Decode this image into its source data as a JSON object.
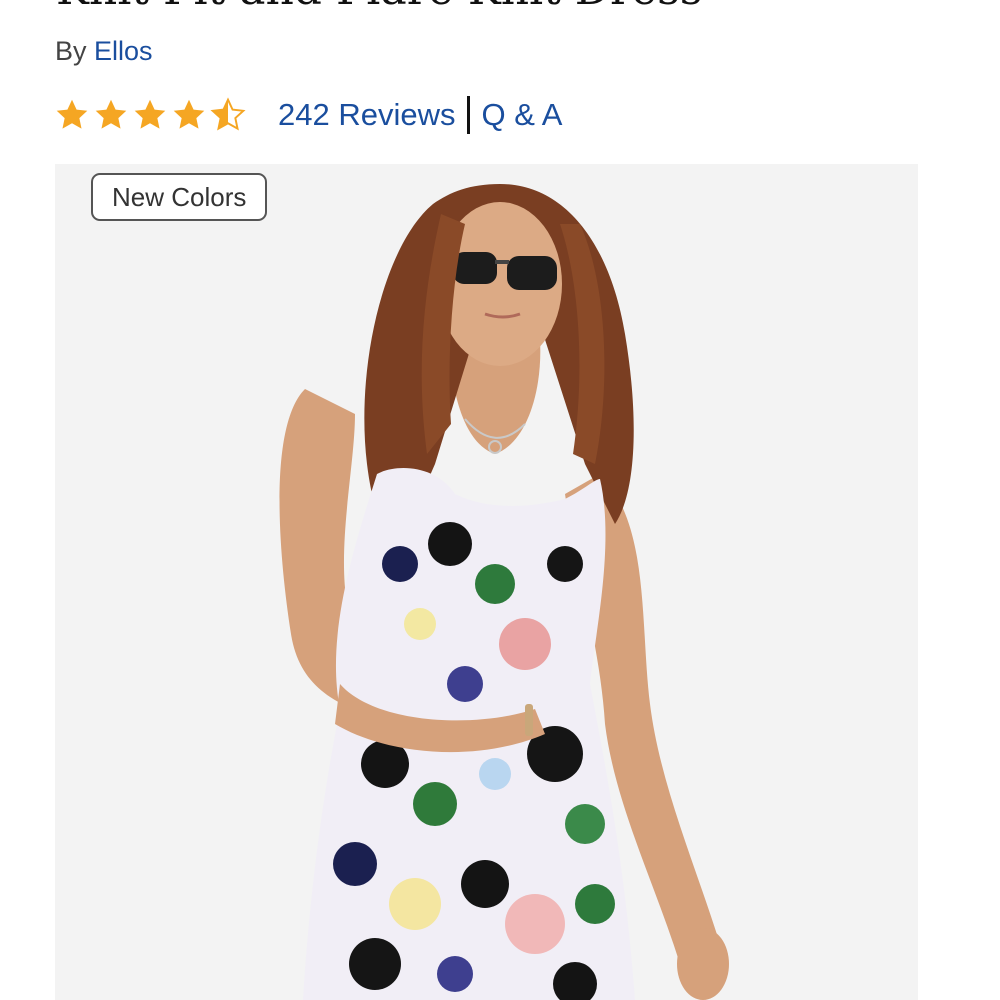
{
  "product": {
    "title": "Knit Fit and Flare Knit Dress",
    "by_prefix": "By",
    "brand": "Ellos"
  },
  "rating": {
    "value": 4.5,
    "max": 5,
    "star_color": "#f5a623",
    "reviews_label": "242 Reviews",
    "qa_label": "Q & A"
  },
  "image": {
    "badge": "New Colors",
    "background_color": "#f3f3f3"
  }
}
